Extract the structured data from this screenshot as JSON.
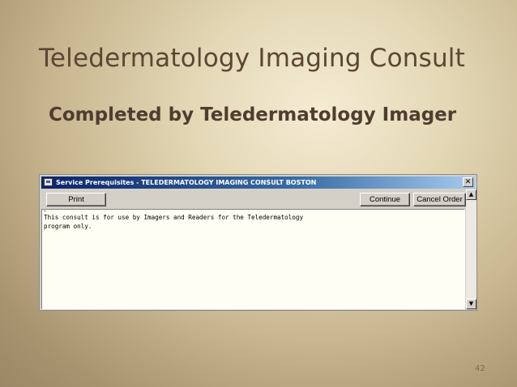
{
  "slide": {
    "title": "Teledermatology Imaging Consult",
    "subtitle": "Completed by Teledermatology Imager",
    "page_number": "42"
  },
  "window": {
    "title": "Service Prerequisites - TELEDERMATOLOGY IMAGING CONSULT BOSTON",
    "close_label": "✕",
    "buttons": {
      "print": "Print",
      "continue": "Continue",
      "cancel": "Cancel Order"
    },
    "text": {
      "line1": "This consult is for use by Imagers and Readers for the Teledermatology",
      "line2": "program only."
    },
    "scroll_up": "▲",
    "scroll_down": "▼"
  },
  "colors": {
    "title_bar": "#0a246a",
    "title_text": "#5b4634",
    "window_face": "#d4d0c8"
  }
}
